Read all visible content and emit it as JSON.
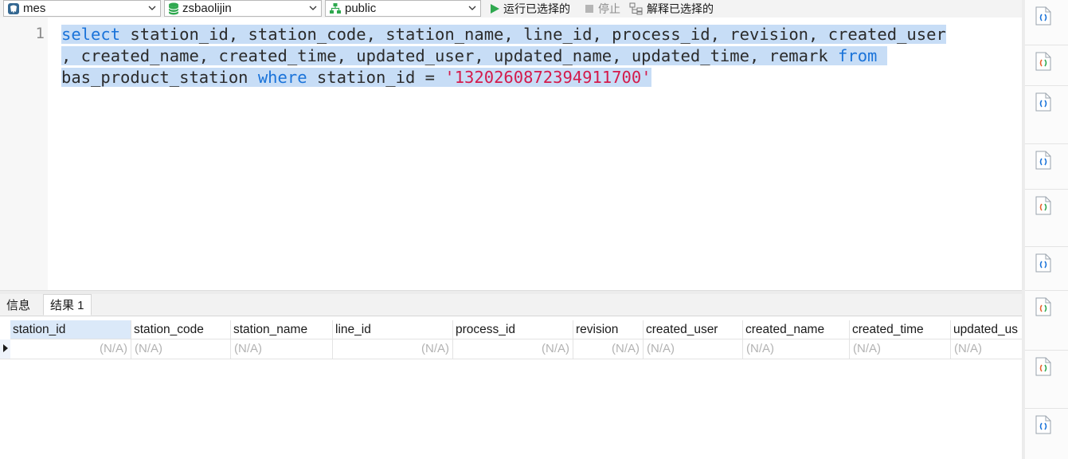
{
  "toolbar": {
    "connection": {
      "label": "mes",
      "icon": "postgresql-elephant-icon"
    },
    "database": {
      "label": "zsbaolijin",
      "icon": "database-icon"
    },
    "schema": {
      "label": "public",
      "icon": "schema-icon"
    },
    "run_selected": "运行已选择的",
    "stop": "停止",
    "explain_selected": "解释已选择的"
  },
  "editor": {
    "line_number": "1",
    "line1_part1": "select",
    "line1_part2": " station_id, station_code, station_name, line_id, process_id, revision, created_user",
    "line2_part1": ", created_name, created_time, updated_user, updated_name, updated_time, remark ",
    "line2_part2": "from",
    "line3_part1": "bas_product_station ",
    "line3_part2": "where",
    "line3_part3": " station_id = ",
    "line3_part4": "'1320260872394911700'"
  },
  "tabs": {
    "info": "信息",
    "result1": "结果 1"
  },
  "grid": {
    "columns": [
      "station_id",
      "station_code",
      "station_name",
      "line_id",
      "process_id",
      "revision",
      "created_user",
      "created_name",
      "created_time",
      "updated_us"
    ],
    "row": [
      "(N/A)",
      "(N/A)",
      "(N/A)",
      "(N/A)",
      "(N/A)",
      "(N/A)",
      "(N/A)",
      "(N/A)",
      "(N/A)",
      "(N/A)"
    ]
  },
  "colors": {
    "keyword": "#1a73d9",
    "string": "#d41a4b",
    "selection": "#c7ddf6"
  },
  "snippets": [
    {
      "icon": "snippet-blue-icon"
    },
    {
      "icon": "snippet-multicolor-icon"
    },
    {
      "icon": "snippet-blue-icon"
    },
    {
      "icon": "snippet-blue-icon"
    },
    {
      "icon": "snippet-multicolor-icon"
    },
    {
      "icon": "snippet-blue-icon"
    },
    {
      "icon": "snippet-multicolor-icon"
    },
    {
      "icon": "snippet-multicolor-icon"
    },
    {
      "icon": "snippet-blue-icon"
    }
  ]
}
